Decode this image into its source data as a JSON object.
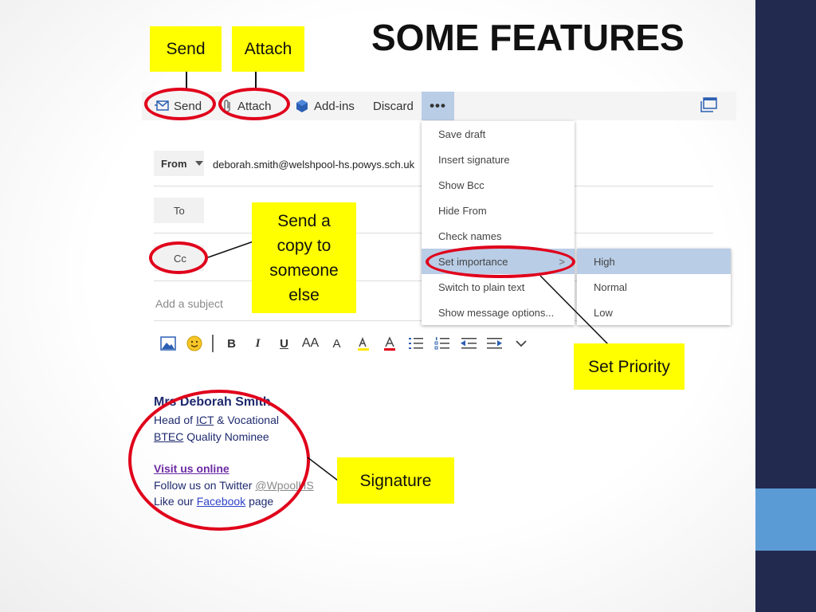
{
  "slide": {
    "title": "SOME FEATURES"
  },
  "callouts": {
    "send": "Send",
    "attach": "Attach",
    "cc_line1": "Send a",
    "cc_line2": "copy to",
    "cc_line3": "someone",
    "cc_line4": "else",
    "priority": "Set Priority",
    "signature": "Signature"
  },
  "toolbar": {
    "send_label": "Send",
    "attach_label": "Attach",
    "addins_label": "Add-ins",
    "discard_label": "Discard",
    "more_label": "•••"
  },
  "compose": {
    "from_label": "From",
    "from_value": "deborah.smith@welshpool-hs.powys.sch.uk",
    "to_label": "To",
    "cc_label": "Cc",
    "subject_placeholder": "Add a subject"
  },
  "format_bar": {
    "bold": "B",
    "italic": "I",
    "underline": "U",
    "font_size": "AA",
    "grow": "A"
  },
  "more_menu": {
    "items": [
      {
        "label": "Save draft"
      },
      {
        "label": "Insert signature"
      },
      {
        "label": "Show Bcc"
      },
      {
        "label": "Hide From"
      },
      {
        "label": "Check names"
      },
      {
        "label": "Set importance",
        "chevron": ">"
      },
      {
        "label": "Switch to plain text"
      },
      {
        "label": "Show message options..."
      }
    ]
  },
  "importance_menu": {
    "items": [
      {
        "label": "High"
      },
      {
        "label": "Normal"
      },
      {
        "label": "Low"
      }
    ]
  },
  "signature": {
    "name": "Mrs Deborah Smith",
    "role_prefix": "Head of ",
    "role_ict": "ICT",
    "role_suffix": " & Vocational",
    "btec": "BTEC",
    "btec_suffix": " Quality Nominee",
    "visit": "Visit us online",
    "twitter_prefix": "Follow us on Twitter ",
    "twitter_handle": "@WpoolHS",
    "facebook_prefix": "Like our ",
    "facebook": "Facebook",
    "facebook_suffix": " page"
  },
  "colors": {
    "callout": "#ffff00",
    "oval": "#e0001b",
    "sidebar": "#232a4f",
    "accent": "#5b9bd5",
    "menu_highlight": "#b9cde6"
  }
}
